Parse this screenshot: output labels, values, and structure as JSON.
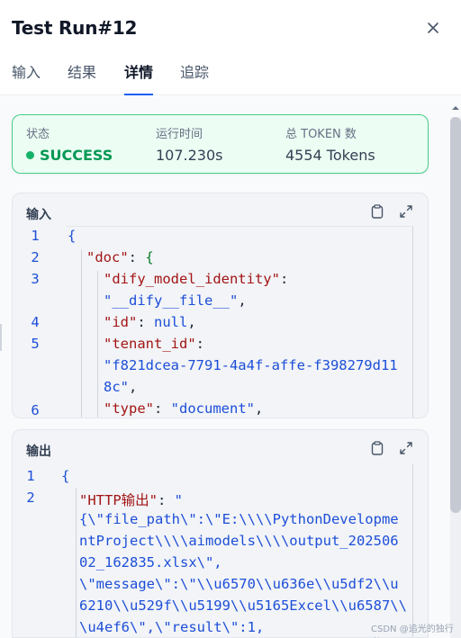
{
  "window": {
    "title": "Test Run#12",
    "close_icon": "close-icon"
  },
  "tabs": [
    {
      "label": "输入",
      "active": false
    },
    {
      "label": "结果",
      "active": false
    },
    {
      "label": "详情",
      "active": true
    },
    {
      "label": "追踪",
      "active": false
    }
  ],
  "status": {
    "state_label": "状态",
    "state_value": "SUCCESS",
    "time_label": "运行时间",
    "time_value": "107.230s",
    "tokens_label": "总 TOKEN 数",
    "tokens_value": "4554 Tokens",
    "colors": {
      "success": "#17b26a",
      "border": "#47cd89",
      "background": "#ecfdf3"
    }
  },
  "input_panel": {
    "title": "输入",
    "icons": [
      "clipboard-icon",
      "expand-icon"
    ],
    "line_numbers": [
      "1",
      "2",
      "3",
      "4",
      "5",
      "6"
    ],
    "lines": {
      "open_brace": "{",
      "doc_key": "\"doc\"",
      "doc_colon": ": ",
      "doc_brace": "{",
      "identity_key": "\"dify_model_identity\"",
      "identity_colon": ":",
      "identity_value": "\"__dify__file__\"",
      "identity_comma": ",",
      "id_key": "\"id\"",
      "id_colon": ": ",
      "id_value": "null",
      "id_comma": ",",
      "tenant_key": "\"tenant_id\"",
      "tenant_colon": ":",
      "tenant_value_1": "\"f821dcea-7791-4a4f-affe-f398279d11",
      "tenant_value_2": "8c\"",
      "tenant_comma": ",",
      "type_key": "\"type\"",
      "type_colon": ": ",
      "type_value": "\"document\"",
      "type_comma": ","
    }
  },
  "output_panel": {
    "title": "输出",
    "icons": [
      "clipboard-icon",
      "expand-icon"
    ],
    "line_numbers": [
      "1",
      "2"
    ],
    "lines": {
      "open_brace": "{",
      "http_key": "\"HTTP输出\"",
      "http_colon": ": ",
      "http_value_0": "\"",
      "http_value_1": "{\\\"file_path\\\":\\\"E:\\\\\\\\PythonDevelopme",
      "http_value_2": "ntProject\\\\\\\\aimodels\\\\\\\\output_202506",
      "http_value_3": "02_162835.xlsx\\\",",
      "http_value_4": "\\\"message\\\":\\\"\\\\u6570\\\\u636e\\\\u5df2\\\\u",
      "http_value_5": "6210\\\\u529f\\\\u5199\\\\u5165Excel\\\\u6587\\\\",
      "http_value_6": "\\u4ef6\\\",\\\"result\\\":1,"
    }
  },
  "watermark": "CSDN @追光的独行者"
}
